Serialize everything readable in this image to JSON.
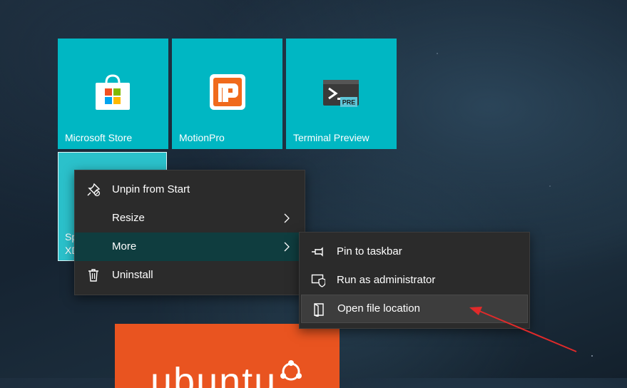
{
  "tiles": {
    "store": {
      "label": "Microsoft Store",
      "icon": "microsoft-store-icon"
    },
    "motionpro": {
      "label": "MotionPro",
      "icon": "motionpro-icon"
    },
    "terminal": {
      "label": "Terminal Preview",
      "icon": "terminal-preview-icon",
      "badge": "PRE"
    },
    "selected": {
      "label_line1": "Sp",
      "label_line2": "XD"
    },
    "ubuntu": {
      "label": "ubuntu",
      "icon": "ubuntu-logo-icon"
    }
  },
  "context_menu": {
    "items": [
      {
        "label": "Unpin from Start",
        "icon": "unpin-icon"
      },
      {
        "label": "Resize",
        "icon": "",
        "submenu": true
      },
      {
        "label": "More",
        "icon": "",
        "submenu": true,
        "active": true
      },
      {
        "label": "Uninstall",
        "icon": "trash-icon"
      }
    ]
  },
  "submenu": {
    "items": [
      {
        "label": "Pin to taskbar",
        "icon": "pin-icon"
      },
      {
        "label": "Run as administrator",
        "icon": "shield-admin-icon"
      },
      {
        "label": "Open file location",
        "icon": "folder-open-icon",
        "highlighted": true
      }
    ]
  },
  "colors": {
    "tile": "#00b7c3",
    "menu_bg": "#2b2b2b",
    "menu_active": "#0f3d3f",
    "ubuntu": "#e95420",
    "annotation_arrow": "#e02a2a"
  }
}
